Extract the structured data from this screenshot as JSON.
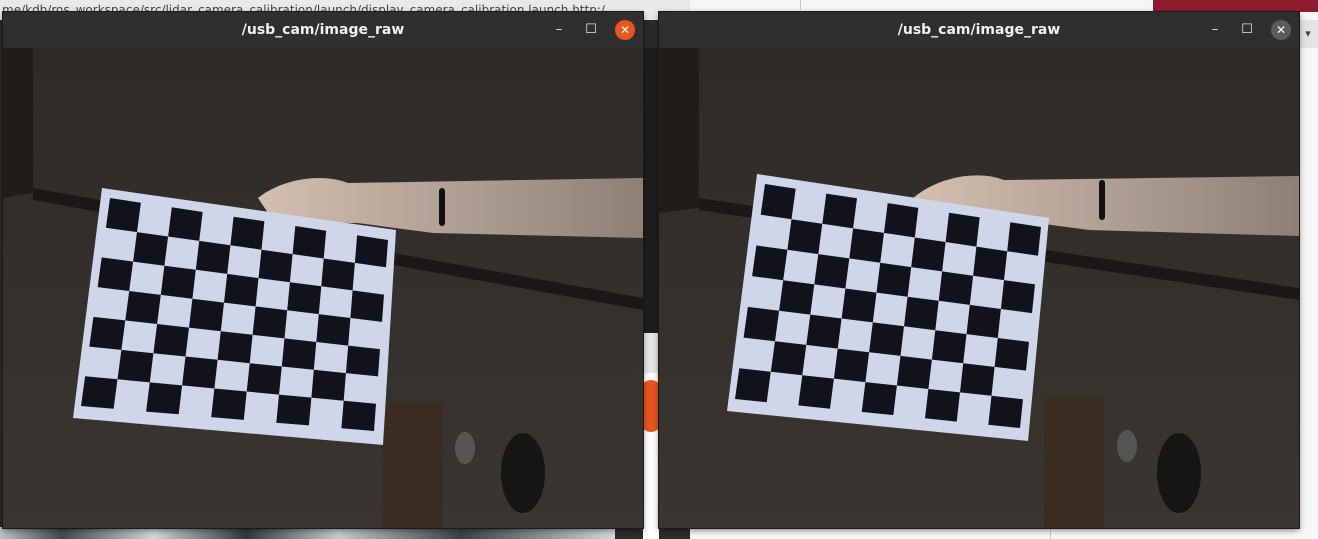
{
  "background": {
    "path_text": "me/kdb/ros_workspace/src/lidar_camera_calibration/launch/display_camera_calibration.launch http:/",
    "dropdown_glyph": "▾"
  },
  "windows": [
    {
      "id": "left",
      "title": "/usb_cam/image_raw",
      "controls": {
        "minimize": "–",
        "maximize": "☐",
        "close": "✕"
      },
      "focused": true
    },
    {
      "id": "right",
      "title": "/usb_cam/image_raw",
      "controls": {
        "minimize": "–",
        "maximize": "☐",
        "close": "✕"
      },
      "focused": false
    }
  ],
  "colors": {
    "titlebar": "#2f2f2f",
    "close_active": "#e95420",
    "close_inactive": "#5c5c5c",
    "board_square": "#12121c",
    "board_paper": "#cfd6ea",
    "wall": "#2d2926",
    "skin": "#cdb8a8"
  },
  "checkerboard": {
    "rows": 7,
    "cols": 9
  }
}
